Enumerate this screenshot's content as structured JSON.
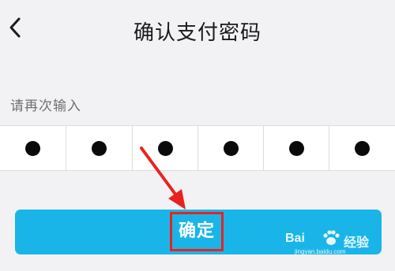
{
  "header": {
    "title": "确认支付密码",
    "back_icon": "chevron-left-icon"
  },
  "pin_entry": {
    "prompt": "请再次输入",
    "digits_total": 6,
    "digits_filled": 6,
    "mask_symbol": "●"
  },
  "confirm_button": {
    "label": "确定",
    "color": "#1ab5e8",
    "highlight_color": "#e8231f"
  },
  "annotation": {
    "arrow_icon": "red-arrow-icon"
  },
  "watermark": {
    "brand_left": "Bai",
    "brand_right": "经验",
    "url": "jingyan.baidu.com"
  }
}
